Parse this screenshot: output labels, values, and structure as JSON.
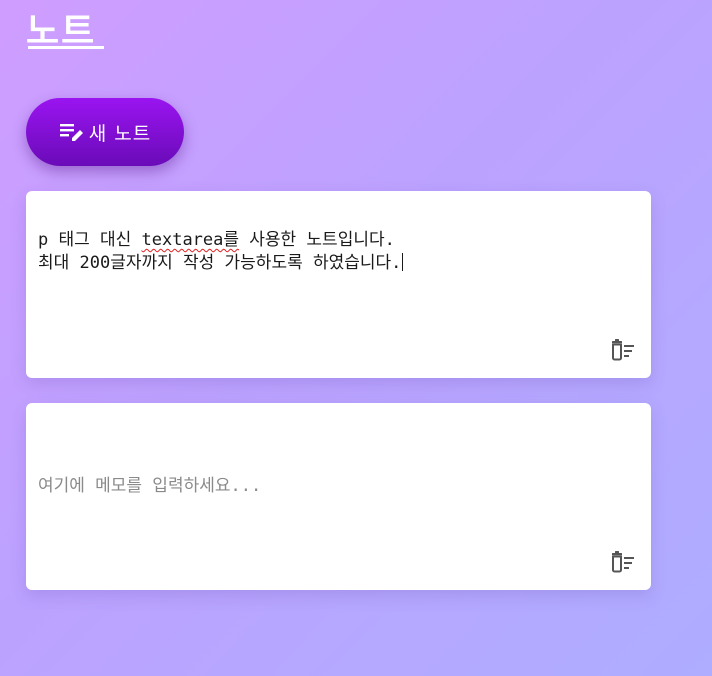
{
  "app": {
    "title": "노트"
  },
  "toolbar": {
    "new_note_label": "새 노트",
    "new_note_icon": "edit-note-icon"
  },
  "notes": [
    {
      "text_before_mark": "p 태그 대신 ",
      "text_marked": "textarea를",
      "text_after_mark": " 사용한 노트입니다.\n최대 200글자까지 작성 가능하도록 하였습니다.",
      "delete_icon": "delete-sweep-icon"
    },
    {
      "value": "",
      "placeholder": "여기에 메모를 입력하세요...",
      "delete_icon": "delete-sweep-icon"
    }
  ],
  "colors": {
    "accent": "#8a12e0",
    "accent_dark": "#6a0bb8",
    "background_start": "#cf9dff",
    "background_end": "#aeadff",
    "card": "#ffffff",
    "icon": "#555555"
  }
}
